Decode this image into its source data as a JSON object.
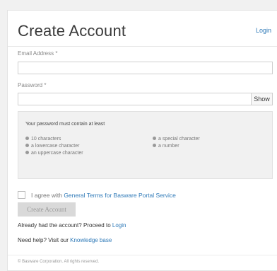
{
  "header": {
    "title": "Create Account",
    "login_link": "Login"
  },
  "form": {
    "email_label": "Email Address *",
    "email_value": "",
    "password_label": "Password *",
    "password_value": "",
    "show_button": "Show"
  },
  "password_rules": {
    "heading": "Your password must contain at least",
    "left": [
      "10 characters",
      "a lowercase character",
      "an uppercase character"
    ],
    "right": [
      "a special character",
      "a number"
    ]
  },
  "terms": {
    "prefix": "I agree with ",
    "link": "General Terms for Basware Portal Service",
    "checked": false
  },
  "create_button": "Create Account",
  "links": {
    "existing_prefix": "Already had the account? Proceed to ",
    "existing_link": "Login",
    "help_prefix": "Need help? Visit our ",
    "help_link": "Knowledge base"
  },
  "footer": "© Basware Corporation. All rights reserved.",
  "colors": {
    "link": "#2f7ab8",
    "disabled_button": "#d9d9d9",
    "rules_background": "#f1f1f1"
  }
}
